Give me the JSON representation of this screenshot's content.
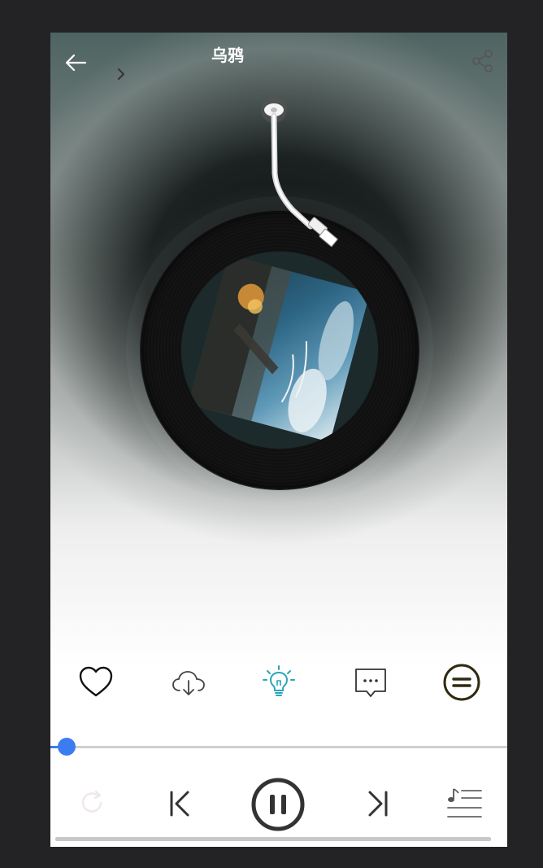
{
  "header": {
    "title": "乌鸦",
    "back_icon": "back-arrow-icon",
    "chevron_icon": "chevron-right-icon",
    "share_icon": "share-icon"
  },
  "player": {
    "album_cover_icon": "album-cover",
    "disc": "vinyl-record",
    "tonearm": "tonearm"
  },
  "actions": [
    {
      "name": "like",
      "icon": "heart-icon"
    },
    {
      "name": "download",
      "icon": "cloud-download-icon"
    },
    {
      "name": "tip",
      "icon": "lightbulb-icon",
      "color": "#2aa6b8"
    },
    {
      "name": "comment",
      "icon": "comment-icon"
    },
    {
      "name": "more",
      "icon": "menu-circle-icon",
      "color": "#2f2a10"
    }
  ],
  "progress": {
    "fraction": 0.036,
    "color": "#3b7cf0"
  },
  "controls": [
    {
      "name": "repeat",
      "icon": "repeat-icon"
    },
    {
      "name": "previous",
      "icon": "previous-icon"
    },
    {
      "name": "pause",
      "icon": "pause-icon"
    },
    {
      "name": "next",
      "icon": "next-icon"
    },
    {
      "name": "playlist",
      "icon": "playlist-icon"
    }
  ]
}
